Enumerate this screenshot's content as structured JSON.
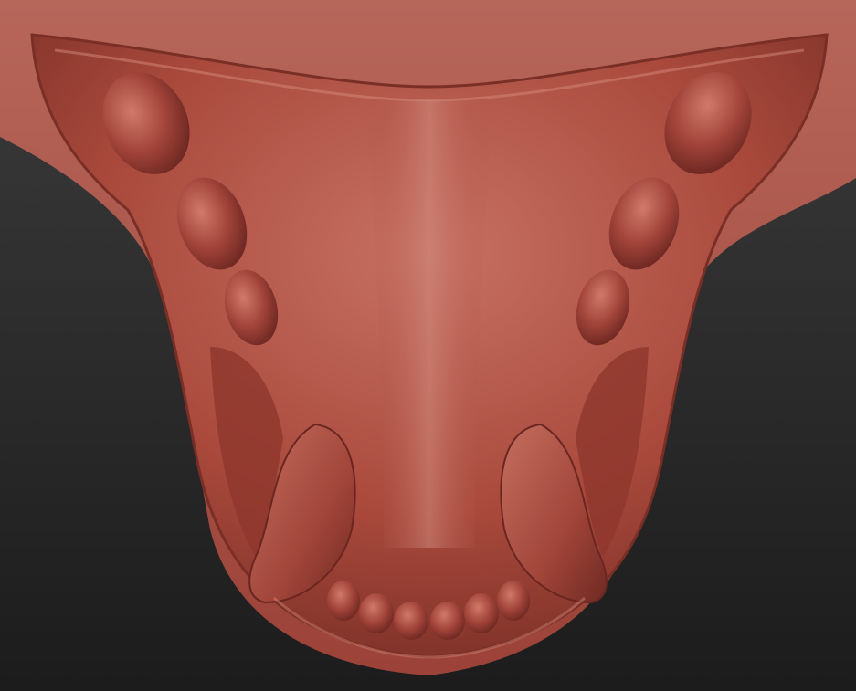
{
  "scene": {
    "subject": "sculpted-palate-mesh",
    "colors": {
      "background_top": "#3a3a3a",
      "background_bottom": "#1a1a1a",
      "clay_light": "#c86a5a",
      "clay_mid": "#a8473a",
      "clay_dark": "#6e2a22",
      "clay_highlight": "#d98a7c"
    }
  }
}
